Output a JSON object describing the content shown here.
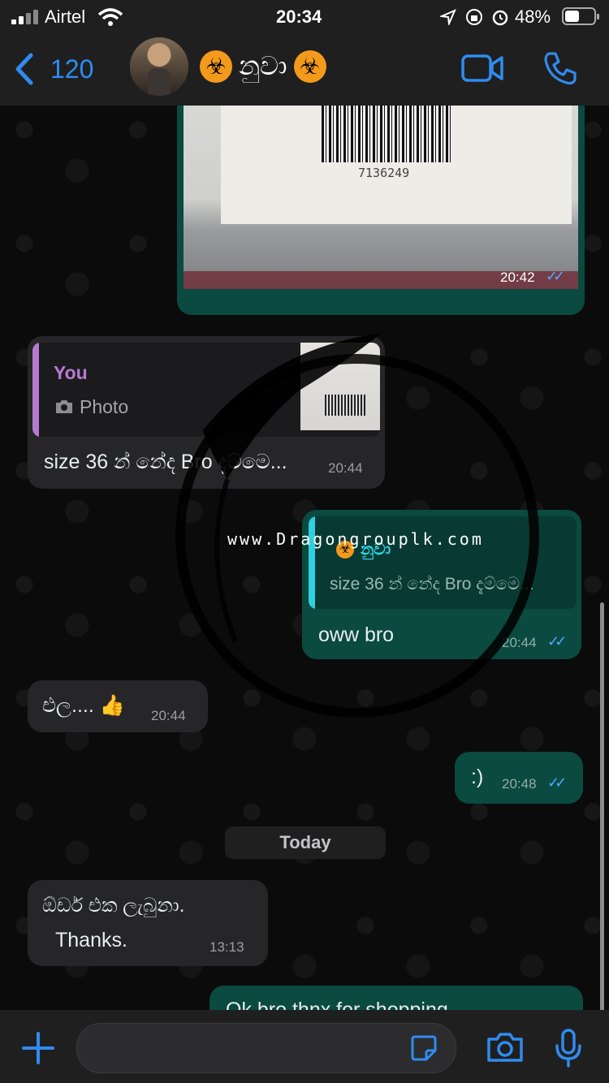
{
  "status_bar": {
    "carrier": "Airtel",
    "time": "20:34",
    "battery": "48%"
  },
  "header": {
    "back_count": "120",
    "contact_name": "නුවා",
    "contact_emoji": "☣"
  },
  "photo_message": {
    "barcode_number": "7136249",
    "time": "20:42",
    "ticks": "✓✓"
  },
  "reply_in": {
    "quote_author": "You",
    "quote_type": "Photo",
    "text": "size 36 න් නේද Bro දැම්මෙ...",
    "time": "20:44"
  },
  "reply_out": {
    "quote_author": "නුවා",
    "quote_text": "size 36 න් නේද Bro දැම්මෙ...",
    "text": "oww bro",
    "time": "20:44",
    "ticks": "✓✓"
  },
  "msg_ela": {
    "text": "එල.... 👍",
    "time": "20:44"
  },
  "msg_smile": {
    "text": ":)",
    "time": "20:48",
    "ticks": "✓✓"
  },
  "date_chip": "Today",
  "msg_order": {
    "line1": "ඕඩර් එක ලැබුනා.",
    "line2": "Thanks.",
    "time": "13:13"
  },
  "msg_last_partial": {
    "text": "Ok bro thnx for shopping"
  },
  "watermark": "www.Dragongrouplk.com"
}
